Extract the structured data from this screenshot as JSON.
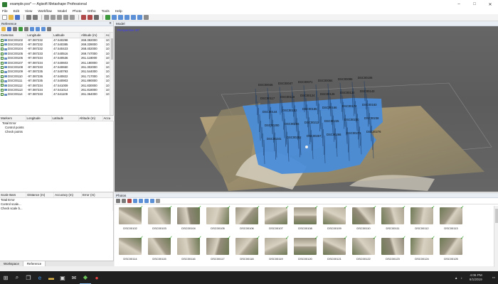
{
  "window": {
    "title": "example.psx* — Agisoft Metashape Professional",
    "controls": [
      "–",
      "□",
      "✕"
    ]
  },
  "menu": [
    "File",
    "Edit",
    "View",
    "Workflow",
    "Model",
    "Photo",
    "Ortho",
    "Tools",
    "Help"
  ],
  "reference": {
    "title": "Reference",
    "cameras_headers": [
      "Cameras",
      "Longitude",
      "Latitude",
      "Altitude (m)",
      "Ac"
    ],
    "cameras": [
      [
        "DSC00102",
        "-97.087232",
        "47.540298",
        "269.392000",
        "10"
      ],
      [
        "DSC00103",
        "-97.087232",
        "47.540385",
        "269.339000",
        "10"
      ],
      [
        "DSC00104",
        "-97.087232",
        "47.540423",
        "268.402000",
        "10"
      ],
      [
        "DSC00105",
        "-97.087233",
        "47.540516",
        "269.747000",
        "10"
      ],
      [
        "DSC00106",
        "-97.087234",
        "47.540536",
        "261.118000",
        "10"
      ],
      [
        "DSC00107",
        "-97.087234",
        "47.540603",
        "261.180000",
        "10"
      ],
      [
        "DSC00108",
        "-97.087233",
        "47.540650",
        "261.302000",
        "10"
      ],
      [
        "DSC00109",
        "-97.087235",
        "47.540793",
        "261.544000",
        "10"
      ],
      [
        "DSC00110",
        "-97.087236",
        "47.540822",
        "261.717000",
        "10"
      ],
      [
        "DSC00111",
        "-97.087235",
        "47.540903",
        "261.890000",
        "10"
      ],
      [
        "DSC00112",
        "-97.087234",
        "47.541009",
        "261.830000",
        "10"
      ],
      [
        "DSC00113",
        "-97.087234",
        "47.541014",
        "261.818000",
        "10"
      ],
      [
        "DSC00114",
        "-97.087233",
        "47.541109",
        "261.364000",
        "10"
      ]
    ],
    "markers_headers": [
      "Markers",
      "Longitude",
      "Latitude",
      "Altitude (m)",
      "Accu"
    ],
    "markers_total": "Total Error",
    "markers_items": [
      "Control points",
      "Check points"
    ],
    "scale_headers": [
      "Scale Bars",
      "Distance (m)",
      "Accuracy (m)",
      "Error (m)"
    ],
    "scale_total": "Total Error",
    "scale_items": [
      "Control scale...",
      "Check scale b..."
    ],
    "tabs": [
      "Workspace",
      "Reference"
    ]
  },
  "model": {
    "title": "Model",
    "projection_label": "Perspective 30°"
  },
  "photos": {
    "title": "Photos",
    "row1": [
      "DSC00102",
      "DSC00103",
      "DSC00104",
      "DSC00105",
      "DSC00106",
      "DSC00107",
      "DSC00108",
      "DSC00109",
      "DSC00110",
      "DSC00111",
      "DSC00112",
      "DSC00113"
    ],
    "row2": [
      "DSC00114",
      "DSC00115",
      "DSC00116",
      "DSC00117",
      "DSC00118",
      "DSC00119",
      "DSC00120",
      "DSC00121",
      "DSC00122",
      "DSC00123",
      "DSC00124",
      "DSC00125"
    ],
    "check_glyph": "✓"
  },
  "model_labels": [
    "DSC00046",
    "DSC00047",
    "DSC00071",
    "DSC00084",
    "DSC00095",
    "DSC00106",
    "DSC00117",
    "DSC00118",
    "DSC00124",
    "DSC00125",
    "DSC00132",
    "DSC00143",
    "DSC00144",
    "DSC00152",
    "DSC00165",
    "DSC00166",
    "DSC00174",
    "DSC00183",
    "DSC00200",
    "DSC00206",
    "DSC00211",
    "DSC00225",
    "DSC00230",
    "DSC00238",
    "DSC00241",
    "DSC00252",
    "DSC00257",
    "DSC00266",
    "DSC00272",
    "DSC00276"
  ],
  "taskbar": {
    "time": "4:06 PM",
    "date": "6/1/2019"
  }
}
